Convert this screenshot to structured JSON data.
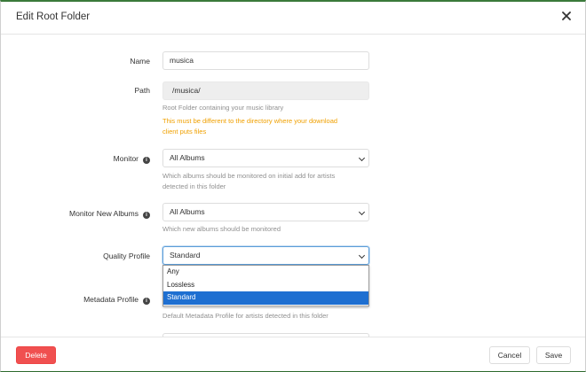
{
  "modal": {
    "title": "Edit Root Folder"
  },
  "fields": {
    "name": {
      "label": "Name",
      "value": "musica"
    },
    "path": {
      "label": "Path",
      "value": "/musica/",
      "help": "Root Folder containing your music library",
      "warning_line1": "This must be different to the directory where your download",
      "warning_line2": "client puts files"
    },
    "monitor": {
      "label": "Monitor",
      "value": "All Albums",
      "help_line1": "Which albums should be monitored on initial add for artists",
      "help_line2": "detected in this folder"
    },
    "monitor_new_albums": {
      "label": "Monitor New Albums",
      "value": "All Albums",
      "help": "Which new albums should be monitored"
    },
    "quality_profile": {
      "label": "Quality Profile",
      "value": "Standard",
      "options": [
        "Any",
        "Lossless",
        "Standard"
      ],
      "selected_option": "Standard"
    },
    "metadata_profile": {
      "label": "Metadata Profile",
      "help": "Default Metadata Profile for artists detected in this folder"
    }
  },
  "footer": {
    "delete_label": "Delete",
    "cancel_label": "Cancel",
    "save_label": "Save"
  },
  "colors": {
    "delete": "#f05050",
    "warning": "#f0a000",
    "dropdown_highlight": "#1e6fd1",
    "top_border": "#3a7a3a"
  }
}
